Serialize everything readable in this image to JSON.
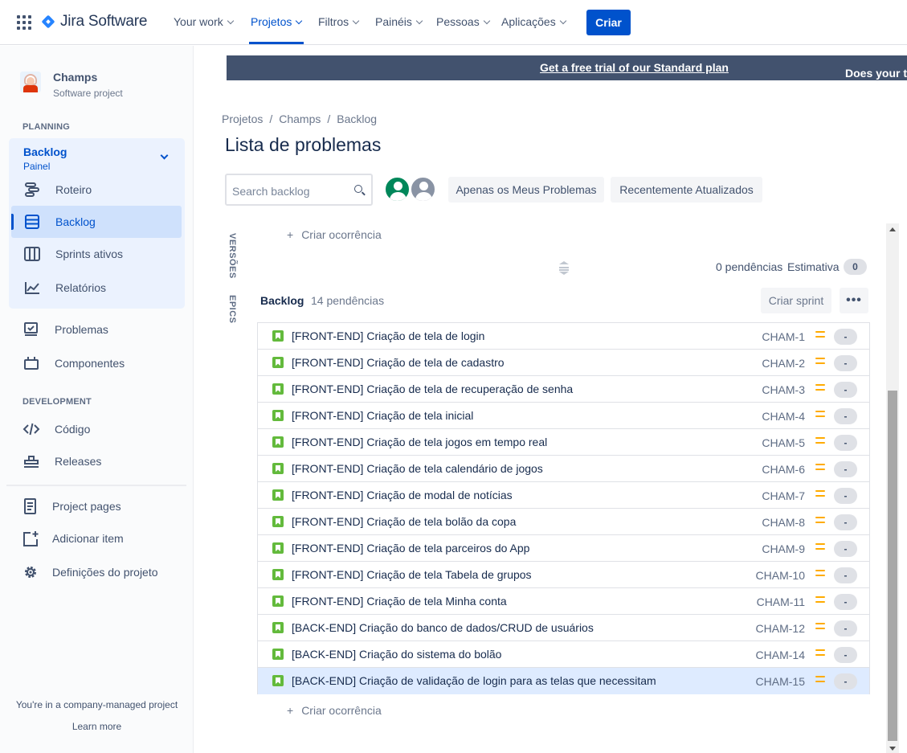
{
  "topnav": {
    "product": "Jira Software",
    "items": [
      {
        "label": "Your work"
      },
      {
        "label": "Projetos"
      },
      {
        "label": "Filtros"
      },
      {
        "label": "Painéis"
      },
      {
        "label": "Pessoas"
      },
      {
        "label": "Aplicações"
      }
    ],
    "active_item": "Projetos",
    "create_label": "Criar"
  },
  "sidebar": {
    "project_name": "Champs",
    "project_type": "Software project",
    "planning_header": "PLANNING",
    "board": {
      "title": "Backlog",
      "subtitle": "Painel"
    },
    "planning_items": [
      {
        "label": "Roteiro",
        "icon": "roadmap-icon"
      },
      {
        "label": "Backlog",
        "icon": "backlog-icon",
        "active": true
      },
      {
        "label": "Sprints ativos",
        "icon": "board-columns-icon"
      },
      {
        "label": "Relatórios",
        "icon": "chart-line-icon"
      }
    ],
    "other_items": [
      {
        "label": "Problemas",
        "icon": "issues-icon"
      },
      {
        "label": "Componentes",
        "icon": "component-icon"
      }
    ],
    "development_header": "DEVELOPMENT",
    "development_items": [
      {
        "label": "Código",
        "icon": "code-icon"
      },
      {
        "label": "Releases",
        "icon": "ship-icon"
      }
    ],
    "bottom_items": [
      {
        "label": "Project pages",
        "icon": "page-icon"
      },
      {
        "label": "Adicionar item",
        "icon": "add-item-icon"
      },
      {
        "label": "Definições do projeto",
        "icon": "gear-icon"
      }
    ],
    "footer_text": "You're in a company-managed project",
    "footer_link": "Learn more"
  },
  "banner": {
    "text": "Does your team need more from Jira?",
    "link": "Get a free trial of our Standard plan"
  },
  "breadcrumbs": [
    "Projetos",
    "Champs",
    "Backlog"
  ],
  "page_title": "Lista de problemas",
  "search": {
    "placeholder": "Search backlog"
  },
  "filters": [
    "Apenas os Meus Problemas",
    "Recentemente Atualizados"
  ],
  "side_tabs": [
    "VERSÕES",
    "EPICS"
  ],
  "sprint_area": {
    "create_issue": "Criar ocorrência",
    "pending": "0 pendências",
    "estimate_label": "Estimativa",
    "estimate_value": "0"
  },
  "backlog": {
    "title": "Backlog",
    "count": "14 pendências",
    "create_sprint": "Criar sprint",
    "more": "•••",
    "create_issue": "Criar ocorrência",
    "issues": [
      {
        "summary": "[FRONT-END] Criação de tela de login",
        "key": "CHAM-1",
        "estimate": "-"
      },
      {
        "summary": "[FRONT-END] Criação de tela de cadastro",
        "key": "CHAM-2",
        "estimate": "-"
      },
      {
        "summary": "[FRONT-END] Criação de tela de recuperação de senha",
        "key": "CHAM-3",
        "estimate": "-"
      },
      {
        "summary": "[FRONT-END] Criação de tela inicial",
        "key": "CHAM-4",
        "estimate": "-"
      },
      {
        "summary": "[FRONT-END] Criação de tela jogos em tempo real",
        "key": "CHAM-5",
        "estimate": "-"
      },
      {
        "summary": "[FRONT-END] Criação de tela calendário de jogos",
        "key": "CHAM-6",
        "estimate": "-"
      },
      {
        "summary": "[FRONT-END] Criação de modal de notícias",
        "key": "CHAM-7",
        "estimate": "-"
      },
      {
        "summary": "[FRONT-END] Criação de tela bolão da copa",
        "key": "CHAM-8",
        "estimate": "-"
      },
      {
        "summary": "[FRONT-END] Criação de tela parceiros do App",
        "key": "CHAM-9",
        "estimate": "-"
      },
      {
        "summary": "[FRONT-END] Criação de tela Tabela de grupos",
        "key": "CHAM-10",
        "estimate": "-"
      },
      {
        "summary": "[FRONT-END] Criação de tela Minha conta",
        "key": "CHAM-11",
        "estimate": "-"
      },
      {
        "summary": "[BACK-END] Criação do banco de dados/CRUD de usuários",
        "key": "CHAM-12",
        "estimate": "-"
      },
      {
        "summary": "[BACK-END] Criação do sistema do bolão",
        "key": "CHAM-14",
        "estimate": "-"
      },
      {
        "summary": "[BACK-END] Criação de validação de login para as telas que necessitam",
        "key": "CHAM-15",
        "estimate": "-",
        "selected": true
      }
    ]
  },
  "colors": {
    "brand": "#0052cc",
    "story": "#63ba3c",
    "priority_medium": "#ffab00",
    "banner": "#42526e"
  }
}
